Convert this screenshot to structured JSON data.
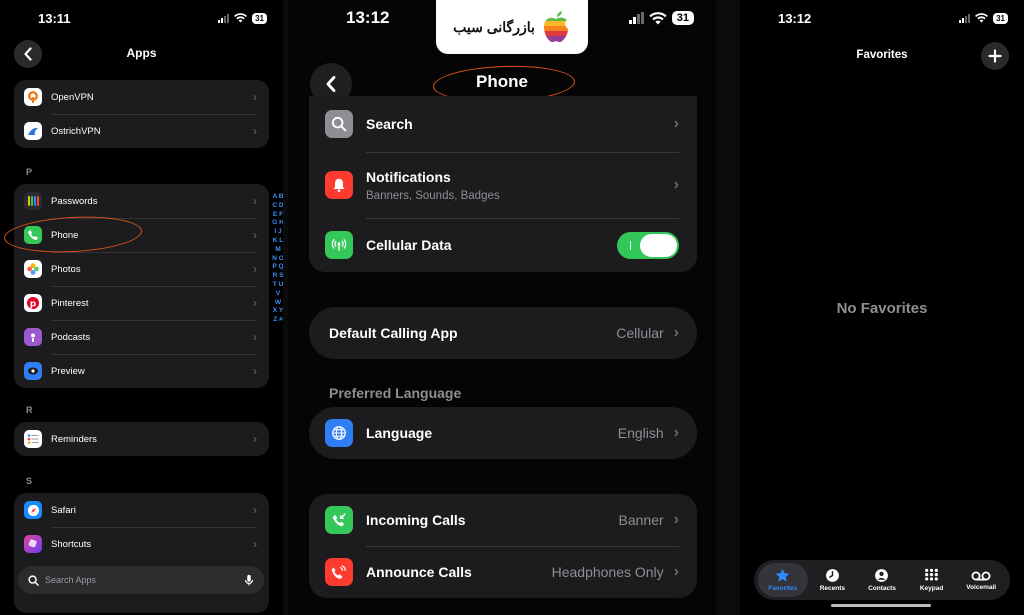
{
  "panel1": {
    "status": {
      "time": "13:11",
      "battery": "31"
    },
    "title": "Apps",
    "group_o": [
      {
        "label": "OpenVPN",
        "icon": "openvpn-icon",
        "color": "#ffffff"
      },
      {
        "label": "OstrichVPN",
        "icon": "ostrich-icon",
        "color": "#ffffff"
      }
    ],
    "section_p": "P",
    "group_p": [
      {
        "label": "Passwords",
        "icon": "key-icon",
        "color": "#2c2c2e"
      },
      {
        "label": "Phone",
        "icon": "phone-icon",
        "color": "#34c759"
      },
      {
        "label": "Photos",
        "icon": "photos-icon",
        "color": "#ffffff"
      },
      {
        "label": "Pinterest",
        "icon": "pinterest-icon",
        "color": "#ffffff"
      },
      {
        "label": "Podcasts",
        "icon": "podcasts-icon",
        "color": "#9b59d0"
      },
      {
        "label": "Preview",
        "icon": "preview-icon",
        "color": "#2f7ef5"
      }
    ],
    "section_r": "R",
    "group_r": [
      {
        "label": "Reminders",
        "icon": "reminders-icon",
        "color": "#ffffff"
      }
    ],
    "section_s": "S",
    "group_s": [
      {
        "label": "Safari",
        "icon": "safari-icon",
        "color": "#1a8cff"
      },
      {
        "label": "Shortcuts",
        "icon": "shortcuts-icon",
        "color": "#6b3ff0"
      }
    ],
    "alphabet": "A B C D E F G H I J K L M N O P Q R S T U V W X Y Z #",
    "search_placeholder": "Search Apps"
  },
  "panel2": {
    "status": {
      "time": "13:12",
      "battery": "31"
    },
    "logo_text": "بازرگانی سیب",
    "nav_title": "Phone",
    "group1": {
      "search": "Search",
      "notifications": "Notifications",
      "notifications_sub": "Banners, Sounds, Badges",
      "cellular": "Cellular Data",
      "cellular_on": true
    },
    "default_calling": {
      "label": "Default Calling App",
      "value": "Cellular"
    },
    "preferred_language_header": "Preferred Language",
    "language": {
      "label": "Language",
      "value": "English"
    },
    "incoming_calls": {
      "label": "Incoming Calls",
      "value": "Banner"
    },
    "announce_calls": {
      "label": "Announce Calls",
      "value": "Headphones Only"
    }
  },
  "panel3": {
    "status": {
      "time": "13:12",
      "battery": "31"
    },
    "title": "Favorites",
    "empty_text": "No Favorites",
    "tabs": [
      {
        "label": "Favorites",
        "icon": "star-icon",
        "active": true
      },
      {
        "label": "Recents",
        "icon": "clock-icon",
        "active": false
      },
      {
        "label": "Contacts",
        "icon": "person-icon",
        "active": false
      },
      {
        "label": "Keypad",
        "icon": "keypad-icon",
        "active": false
      },
      {
        "label": "Voicemail",
        "icon": "voicemail-icon",
        "active": false
      }
    ]
  },
  "colors": {
    "accent_blue": "#2f8cff",
    "annotation_orange": "#e0521b",
    "toggle_green": "#33c759"
  }
}
